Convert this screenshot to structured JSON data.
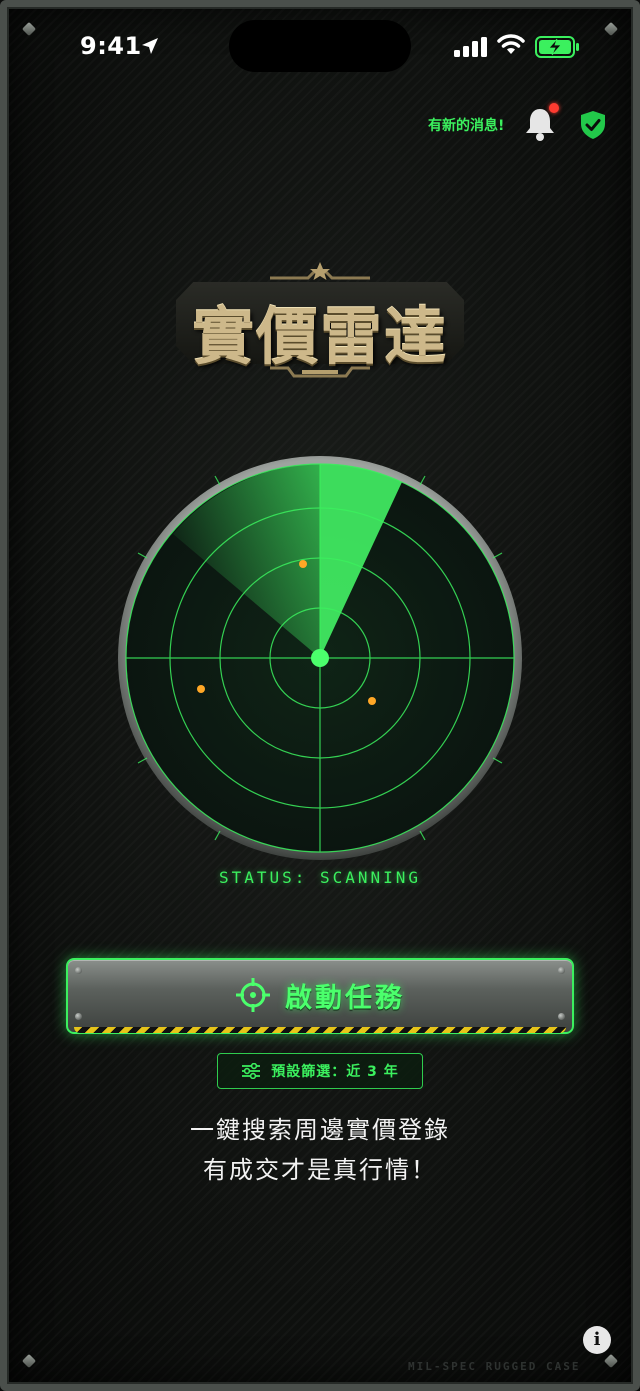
{
  "status_bar": {
    "time": "9:41"
  },
  "notification": {
    "text": "有新的消息!"
  },
  "app": {
    "logo_text": "實價雷達"
  },
  "radar": {
    "status": "STATUS: SCANNING",
    "blip_color": "#ffa726",
    "accent_color": "#3bf05e"
  },
  "actions": {
    "start_mission_label": "啟動任務",
    "filter_label": "預設篩選：近 3 年"
  },
  "tagline": {
    "line1": "一鍵搜索周邊實價登錄",
    "line2": "有成交才是真行情！"
  },
  "footer": {
    "case_label": "MIL-SPEC RUGGED CASE",
    "info_icon": "i"
  }
}
